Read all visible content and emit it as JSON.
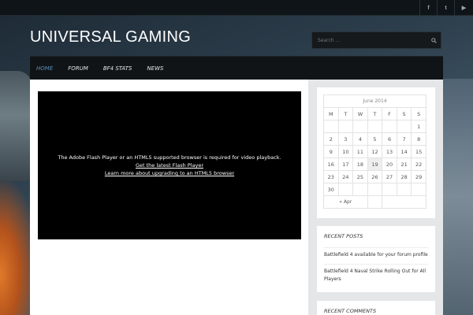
{
  "site": {
    "title": "UNIVERSAL GAMING"
  },
  "social": [
    {
      "icon": "facebook-icon",
      "glyph": "f"
    },
    {
      "icon": "twitter-icon",
      "glyph": "t"
    },
    {
      "icon": "youtube-icon",
      "glyph": "▶"
    }
  ],
  "search": {
    "placeholder": "Search ..."
  },
  "nav": {
    "items": [
      {
        "label": "HOME",
        "active": true
      },
      {
        "label": "FORUM"
      },
      {
        "label": "BF4 STATS"
      },
      {
        "label": "NEWS"
      }
    ]
  },
  "video": {
    "message": "The Adobe Flash Player or an HTML5 supported browser is required for video playback.",
    "link1": "Get the latest Flash Player",
    "link2": "Learn more about upgrading to an HTML5 browser"
  },
  "calendar": {
    "caption": "June 2014",
    "days": [
      "M",
      "T",
      "W",
      "T",
      "F",
      "S",
      "S"
    ],
    "weeks": [
      [
        "",
        "",
        "",
        "",
        "",
        "",
        "1"
      ],
      [
        "2",
        "3",
        "4",
        "5",
        "6",
        "7",
        "8"
      ],
      [
        "9",
        "10",
        "11",
        "12",
        "13",
        "14",
        "15"
      ],
      [
        "16",
        "17",
        "18",
        "19",
        "20",
        "21",
        "22"
      ],
      [
        "23",
        "24",
        "25",
        "26",
        "27",
        "28",
        "29"
      ],
      [
        "30",
        "",
        "",
        "",
        "",
        "",
        ""
      ]
    ],
    "today": "19",
    "prev_link": "« Apr"
  },
  "recent_posts": {
    "title": "RECENT POSTS",
    "items": [
      "Battlefield 4 available for your forum profile",
      "Battlefield 4 Naval Strike Rolling Out for All Players"
    ]
  },
  "recent_comments": {
    "title": "RECENT COMMENTS"
  },
  "colors": {
    "accent": "#5a8fb6",
    "nav_bg": "#101417"
  }
}
